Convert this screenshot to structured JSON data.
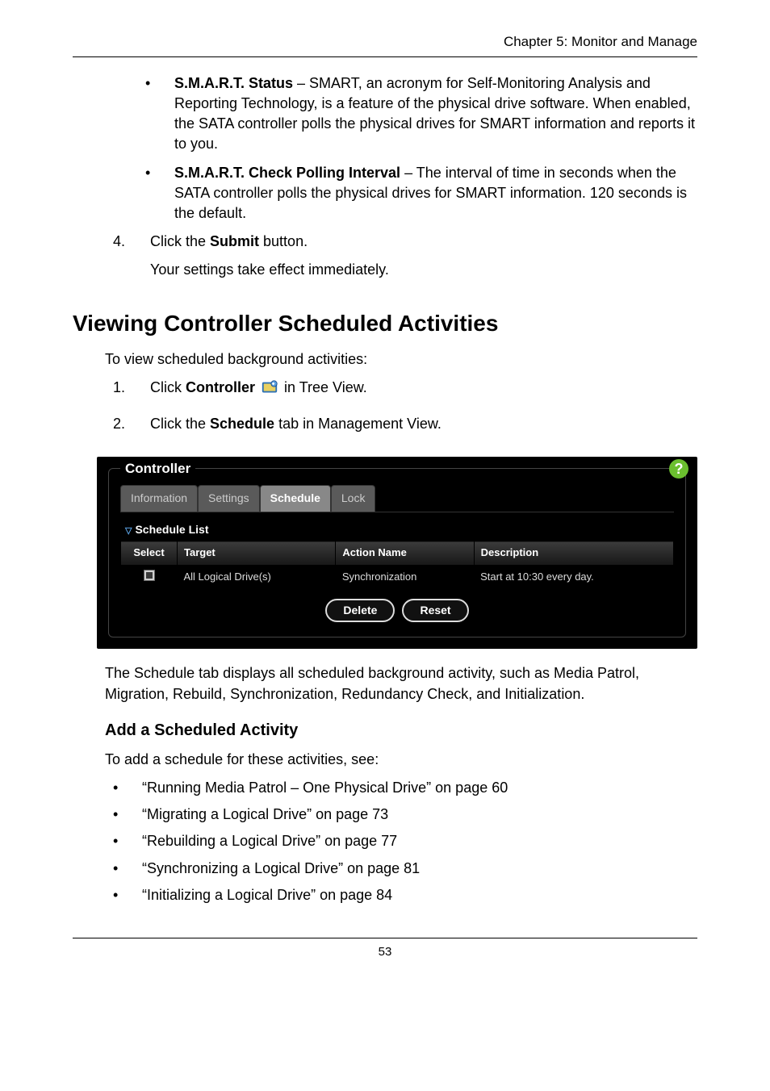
{
  "header": {
    "chapter": "Chapter 5: Monitor and Manage"
  },
  "smart_status": {
    "term": "S.M.A.R.T. Status",
    "desc": " – SMART, an acronym for Self-Monitoring Analysis and Reporting Technology, is a feature of the physical drive software. When enabled, the SATA controller polls the physical drives for SMART information and reports it to you."
  },
  "smart_interval": {
    "term": "S.M.A.R.T. Check Polling Interval",
    "desc": " – The interval of time in seconds when the SATA controller polls the physical drives for SMART information. 120 seconds is the default."
  },
  "step4": {
    "num": "4.",
    "line1a": "Click the ",
    "line1b": "Submit",
    "line1c": " button.",
    "line2": "Your settings take effect immediately."
  },
  "section_heading": "Viewing Controller Scheduled Activities",
  "intro": "To view scheduled background activities:",
  "step1": {
    "num": "1.",
    "a": "Click ",
    "b": "Controller ",
    "c": " in Tree View."
  },
  "step2": {
    "num": "2.",
    "a": "Click the ",
    "b": "Schedule",
    "c": " tab in Management View."
  },
  "panel": {
    "title": "Controller",
    "help": "?",
    "tabs": {
      "information": "Information",
      "settings": "Settings",
      "schedule": "Schedule",
      "lock": "Lock"
    },
    "list_title": "Schedule List",
    "headers": {
      "select": "Select",
      "target": "Target",
      "action": "Action Name",
      "desc": "Description"
    },
    "row": {
      "target": "All Logical Drive(s)",
      "action": "Synchronization",
      "desc": "Start at 10:30 every day."
    },
    "buttons": {
      "delete": "Delete",
      "reset": "Reset"
    }
  },
  "after_panel": "The Schedule tab displays all scheduled background activity, such as Media Patrol, Migration, Rebuild, Synchronization, Redundancy Check, and Initialization.",
  "subsection": "Add a Scheduled Activity",
  "add_intro": "To add a schedule for these activities, see:",
  "refs": {
    "r1": "“Running Media Patrol – One Physical Drive” on page 60",
    "r2": "“Migrating a Logical Drive” on page 73",
    "r3": "“Rebuilding a Logical Drive” on page 77",
    "r4": "“Synchronizing a Logical Drive” on page 81",
    "r5": "“Initializing a Logical Drive” on page 84"
  },
  "footer": {
    "page": "53"
  }
}
